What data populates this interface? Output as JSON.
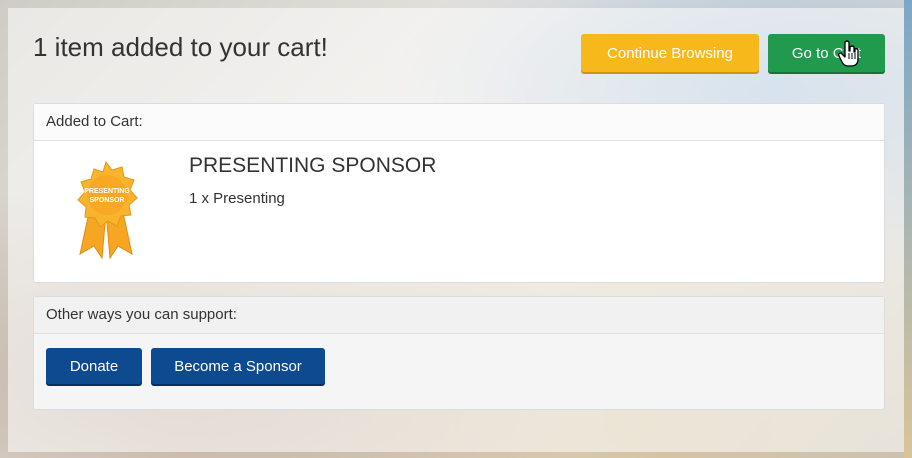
{
  "header": {
    "title": "1 item added to your cart!",
    "continue_label": "Continue Browsing",
    "cart_label": "Go to Cart"
  },
  "cart_panel": {
    "heading": "Added to Cart:",
    "item": {
      "name": "PRESENTING SPONSOR",
      "quantity_text": "1 x Presenting",
      "badge_text_line1": "PRESENTING",
      "badge_text_line2": "SPONSOR"
    }
  },
  "support_panel": {
    "heading": "Other ways you can support:",
    "donate_label": "Donate",
    "sponsor_label": "Become a Sponsor"
  },
  "colors": {
    "continue": "#f7b81c",
    "cart": "#219a4e",
    "action_blue": "#0e4a8f",
    "badge": "#f6a623"
  },
  "icons": [
    "ribbon-badge-icon",
    "hand-cursor-icon"
  ]
}
